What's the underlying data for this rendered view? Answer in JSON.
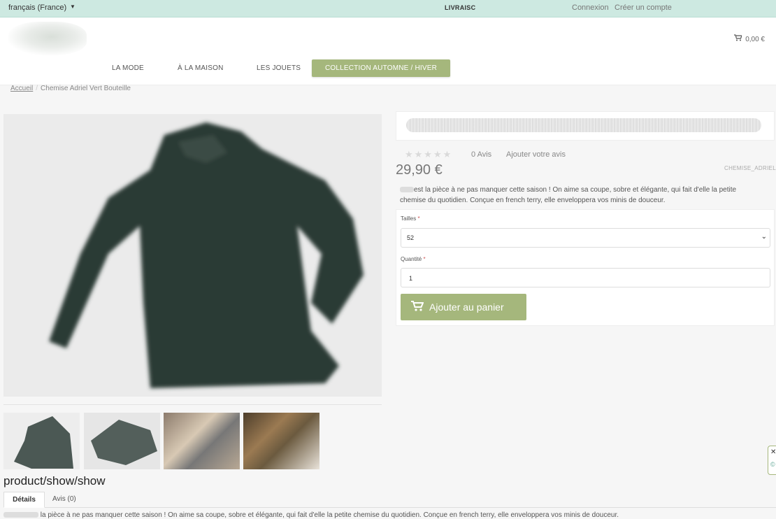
{
  "topbar": {
    "language": "français (France)",
    "shipping_banner": "LIVRAISC",
    "login": "Connexion",
    "register": "Créer un compte"
  },
  "header": {
    "cart_total": "0,00 €",
    "nav": [
      "LA MODE",
      "À LA MAISON",
      "LES JOUETS",
      "COLLECTION AUTOMNE / HIVER"
    ]
  },
  "breadcrumb": {
    "home": "Accueil",
    "current": "Chemise Adriel Vert Bouteille"
  },
  "product": {
    "stars": "★★★★★",
    "review_count": "0 Avis",
    "add_review": "Ajouter votre avis",
    "price": "29,90 €",
    "reference": "CHEMISE_ADRIEL",
    "description": "est la pièce à ne pas manquer cette saison ! On aime sa coupe, sobre et élégante, qui fait d'elle la petite chemise du quotidien. Conçue en french terry, elle enveloppera vos minis de douceur.",
    "size_label": "Tailles",
    "size_value": "52",
    "quantity_label": "Quantité",
    "quantity_value": "1",
    "add_to_cart": "Ajouter au panier",
    "required_mark": "*"
  },
  "bottom": {
    "section_title": "product/show/show",
    "tabs": [
      "Détails",
      "Avis (0)"
    ],
    "description": "la pièce à ne pas manquer cette saison ! On aime sa coupe, sobre et élégante, qui fait d'elle la petite chemise du quotidien. Conçue en french terry, elle enveloppera vos minis de douceur."
  },
  "colors": {
    "accent": "#a5b77c",
    "topbar": "#cde9e1",
    "shirt": "#2c3b36"
  }
}
